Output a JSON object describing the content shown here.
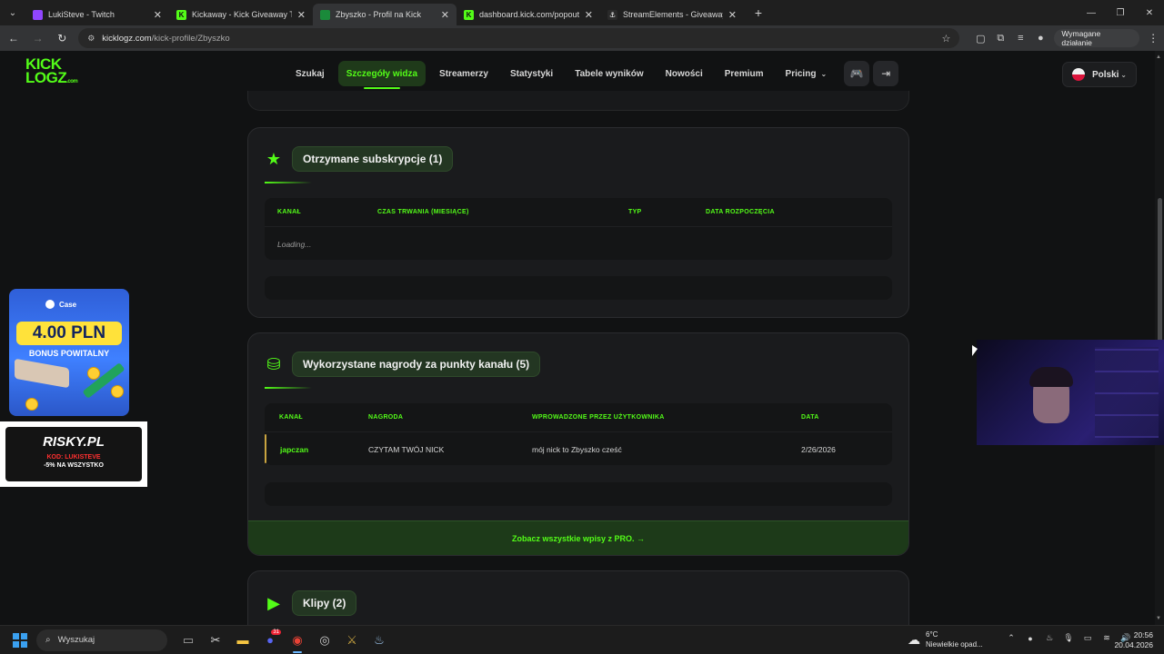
{
  "browser": {
    "tabs": [
      {
        "title": "LukiSteve - Twitch",
        "color": "#9146ff",
        "glyph": "▮"
      },
      {
        "title": "Kickaway - Kick Giveaway Tool",
        "color": "#53fc18",
        "glyph": "K"
      },
      {
        "title": "Zbyszko - Profil na Kick",
        "color": "#1a8a3a",
        "glyph": "▪",
        "active": true
      },
      {
        "title": "dashboard.kick.com/popout/lu",
        "color": "#53fc18",
        "glyph": "K"
      },
      {
        "title": "StreamElements - Giveaways",
        "color": "#ffffff",
        "glyph": "⚓"
      }
    ],
    "url_domain": "kicklogz.com",
    "url_path": "/kick-profile/Zbyszko",
    "action_label": "Wymagane działanie"
  },
  "site": {
    "logo_line1": "KICK",
    "logo_line2": "LOGZ",
    "logo_suffix": ".com",
    "nav": [
      {
        "label": "Szukaj"
      },
      {
        "label": "Szczegóły widza",
        "active": true
      },
      {
        "label": "Streamerzy"
      },
      {
        "label": "Statystyki"
      },
      {
        "label": "Tabele wyników"
      },
      {
        "label": "Nowości"
      },
      {
        "label": "Premium"
      },
      {
        "label": "Pricing"
      }
    ],
    "language": "Polski"
  },
  "subscriptions": {
    "title": "Otrzymane subskrypcje (1)",
    "columns": [
      "KANAŁ",
      "CZAS TRWANIA (MIESIĄCE)",
      "TYP",
      "DATA ROZPOCZĘCIA"
    ],
    "loading_text": "Loading..."
  },
  "rewards": {
    "title": "Wykorzystane nagrody za punkty kanału (5)",
    "columns": [
      "KANAŁ",
      "NAGRODA",
      "WPROWADZONE PRZEZ UŻYTKOWNIKA",
      "DATA"
    ],
    "rows": [
      {
        "channel": "japczan",
        "reward": "CZYTAM TWÓJ NICK",
        "input": "mój nick to Zbyszko cześć",
        "date": "2/26/2026"
      }
    ],
    "pro_cta": "Zobacz wszystkie wpisy z PRO. →"
  },
  "clips": {
    "title": "Klipy (2)"
  },
  "ads": {
    "case_brand": "Case",
    "case_amount": "4.00 PLN",
    "case_bonus": "BONUS POWITALNY",
    "risky_name": "RISKY.PL",
    "risky_code": "KOD: LUKISTEVE",
    "risky_discount": "-5% NA WSZYSTKO"
  },
  "taskbar": {
    "search_placeholder": "Wyszukaj",
    "weather_temp": "6°C",
    "weather_desc": "Niewielkie opad...",
    "time": "20:56",
    "date": "20.04.2026",
    "discord_badge": "31"
  }
}
